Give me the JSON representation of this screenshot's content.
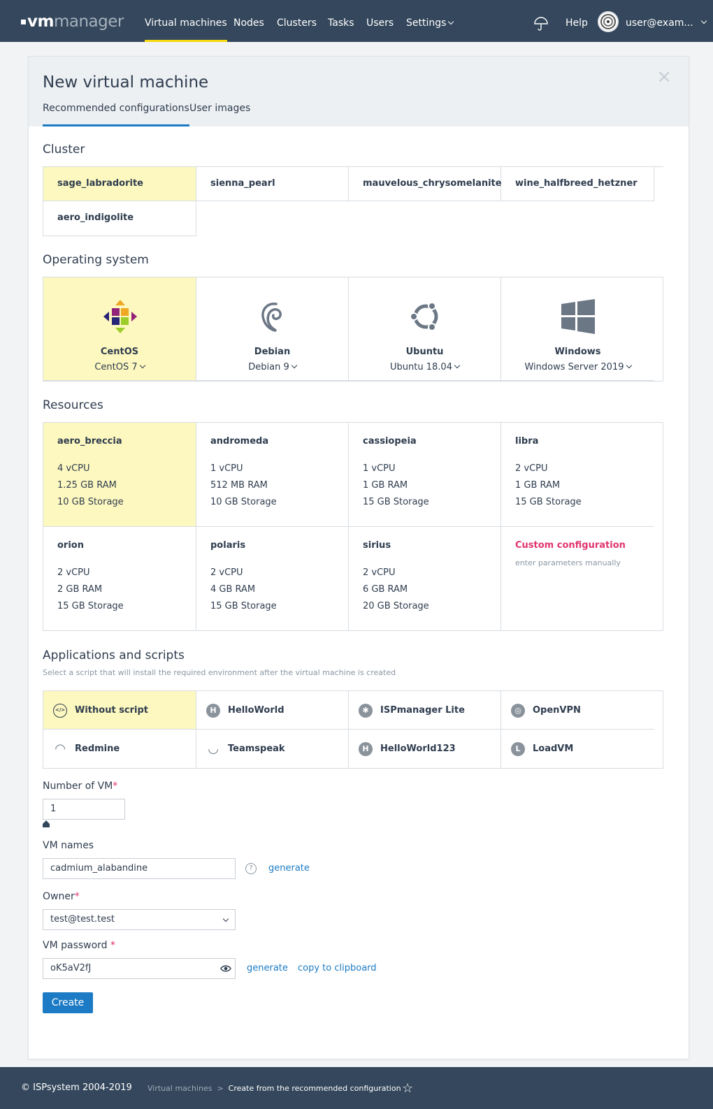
{
  "header": {
    "logo_bold": "vm",
    "logo_light": "manager",
    "nav": [
      "Virtual machines",
      "Nodes",
      "Clusters",
      "Tasks",
      "Users",
      "Settings"
    ],
    "help": "Help",
    "user": "user@exam..."
  },
  "dialog": {
    "title": "New virtual machine",
    "tabs": [
      "Recommended configurations",
      "User images"
    ],
    "close": "×"
  },
  "cluster": {
    "heading": "Cluster",
    "items": [
      "sage_labradorite",
      "sienna_pearl",
      "mauvelous_chrysomelanite",
      "wine_halfbreed_hetzner",
      "aero_indigolite"
    ]
  },
  "os": {
    "heading": "Operating system",
    "items": [
      {
        "name": "CentOS",
        "version": "CentOS 7",
        "icon": "centos-icon"
      },
      {
        "name": "Debian",
        "version": "Debian 9",
        "icon": "debian-icon"
      },
      {
        "name": "Ubuntu",
        "version": "Ubuntu 18.04",
        "icon": "ubuntu-icon"
      },
      {
        "name": "Windows",
        "version": "Windows Server 2019",
        "icon": "windows-icon"
      }
    ]
  },
  "resources": {
    "heading": "Resources",
    "items": [
      {
        "name": "aero_breccia",
        "cpu": "4 vCPU",
        "ram": "1.25 GB RAM",
        "storage": "10 GB Storage"
      },
      {
        "name": "andromeda",
        "cpu": "1 vCPU",
        "ram": "512 MB RAM",
        "storage": "10 GB Storage"
      },
      {
        "name": "cassiopeia",
        "cpu": "1 vCPU",
        "ram": "1 GB RAM",
        "storage": "15 GB Storage"
      },
      {
        "name": "libra",
        "cpu": "2 vCPU",
        "ram": "1 GB RAM",
        "storage": "15 GB Storage"
      },
      {
        "name": "orion",
        "cpu": "2 vCPU",
        "ram": "2 GB RAM",
        "storage": "15 GB Storage"
      },
      {
        "name": "polaris",
        "cpu": "2 vCPU",
        "ram": "4 GB RAM",
        "storage": "15 GB Storage"
      },
      {
        "name": "sirius",
        "cpu": "2 vCPU",
        "ram": "6 GB RAM",
        "storage": "20 GB Storage"
      }
    ],
    "custom_title": "Custom configuration",
    "custom_sub": "enter parameters manually"
  },
  "apps": {
    "heading": "Applications and scripts",
    "hint": "Select a script that will install the required environment after the virtual machine is created",
    "items": [
      {
        "name": "Without script",
        "icon": "code-icon",
        "glyph": "</>"
      },
      {
        "name": "HelloWorld",
        "icon": "h-letter-icon",
        "glyph": "H"
      },
      {
        "name": "ISPmanager Lite",
        "icon": "ispmanager-icon",
        "glyph": "✱"
      },
      {
        "name": "OpenVPN",
        "icon": "openvpn-icon",
        "glyph": "◎"
      },
      {
        "name": "Redmine",
        "icon": "redmine-icon",
        "glyph": "◠"
      },
      {
        "name": "Teamspeak",
        "icon": "teamspeak-icon",
        "glyph": "◡"
      },
      {
        "name": "HelloWorld123",
        "icon": "h-letter-icon",
        "glyph": "H"
      },
      {
        "name": "LoadVM",
        "icon": "l-letter-icon",
        "glyph": "L"
      }
    ]
  },
  "form": {
    "vm_count_label": "Number of VM",
    "vm_count": "1",
    "names_label": "VM names",
    "names_value": "cadmium_alabandine",
    "generate": "generate",
    "owner_label": "Owner",
    "owner_value": "test@test.test",
    "password_label": "VM password",
    "password_value": "oK5aV2fJ",
    "copy": "copy to clipboard",
    "create": "Create",
    "required_mark": "*",
    "help_mark": "?"
  },
  "footer": {
    "copyright": "© ISPsystem 2004-2019",
    "breadcrumb_parent": "Virtual machines",
    "breadcrumb_sep": ">",
    "breadcrumb_current": "Create from the recommended configuration"
  },
  "colors": {
    "accent": "#1c7bc4",
    "selected": "#fdf8bf",
    "header": "#34475c",
    "required": "#e0346f",
    "nav_active": "#f5d80e"
  }
}
